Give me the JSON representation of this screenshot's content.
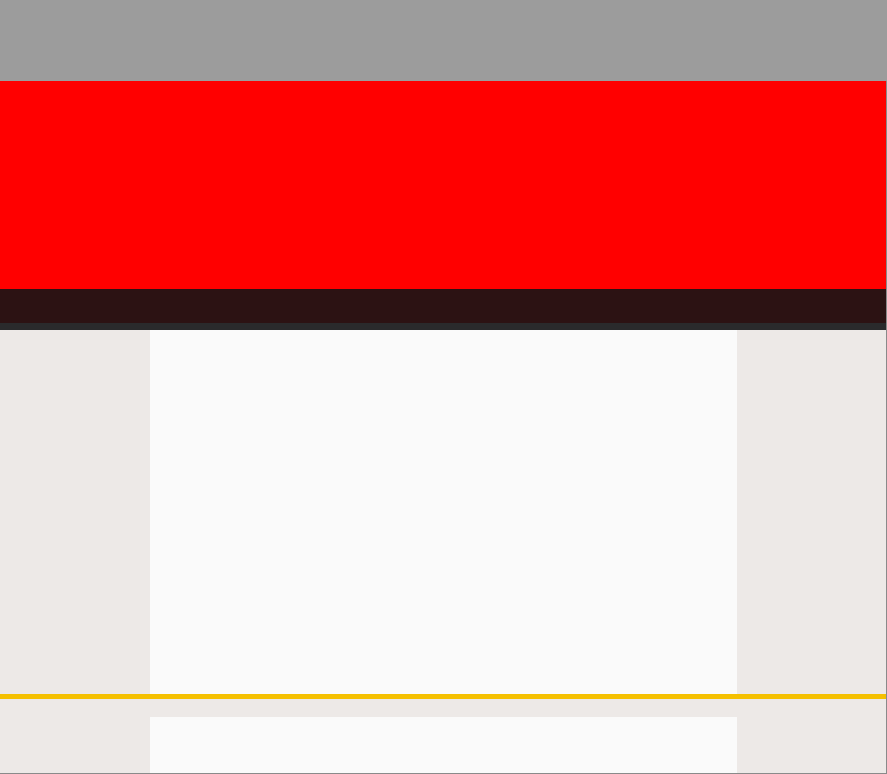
{
  "colors": {
    "top_bar": "#9c9c9c",
    "hero_banner": "#ff0000",
    "nav_bar": "#2c1213",
    "nav_divider": "#2a2a2c",
    "page_background": "#ede9e7",
    "content_background": "#fafafa",
    "accent_rule": "#f5c000",
    "frame_border": "#8a8a8a"
  }
}
